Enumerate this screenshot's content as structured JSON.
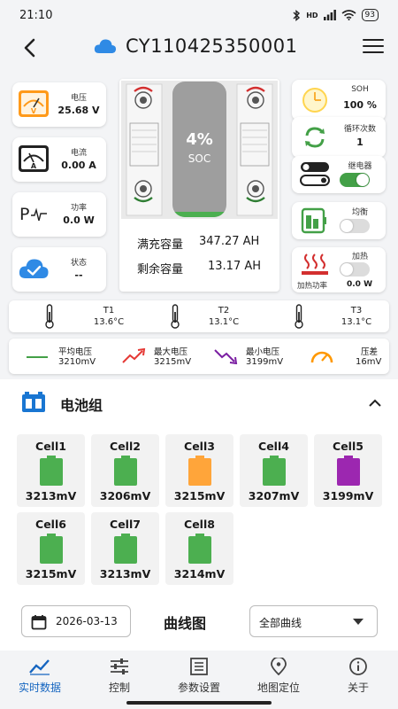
{
  "status_bar": {
    "time": "21:10",
    "network": "HD",
    "battery": "93"
  },
  "header": {
    "title": "CY110425350001"
  },
  "left_metrics": [
    {
      "label": "电压",
      "value": "25.68 V"
    },
    {
      "label": "电流",
      "value": "0.00 A"
    },
    {
      "label": "功率",
      "value": "0.0 W"
    },
    {
      "label": "状态",
      "value": "--"
    }
  ],
  "battery_center": {
    "soc_percent": "4%",
    "soc_label": "SOC",
    "soc_fraction": 0.04,
    "full_capacity_label": "满充容量",
    "full_capacity_value": "347.27 AH",
    "remaining_capacity_label": "剩余容量",
    "remaining_capacity_value": "13.17 AH"
  },
  "right_metrics": {
    "soh": {
      "label": "SOH",
      "value": "100 %"
    },
    "cycles": {
      "label": "循环次数",
      "value": "1"
    },
    "relay": {
      "label": "继电器",
      "on": true
    },
    "balance": {
      "label": "均衡",
      "on": false
    },
    "heating": {
      "label": "加热",
      "on": false,
      "power_label": "加热功率",
      "power_value": "0.0 W"
    }
  },
  "temperatures": [
    {
      "label": "T1",
      "value": "13.6°C"
    },
    {
      "label": "T2",
      "value": "13.1°C"
    },
    {
      "label": "T3",
      "value": "13.1°C"
    }
  ],
  "voltage_stats": [
    {
      "label": "平均电压",
      "value": "3210mV"
    },
    {
      "label": "最大电压",
      "value": "3215mV"
    },
    {
      "label": "最小电压",
      "value": "3199mV"
    },
    {
      "label": "压差",
      "value": "16mV"
    }
  ],
  "battery_pack": {
    "title": "电池组",
    "cells": [
      {
        "name": "Cell1",
        "voltage": "3213mV",
        "color": "#4caf50"
      },
      {
        "name": "Cell2",
        "voltage": "3206mV",
        "color": "#4caf50"
      },
      {
        "name": "Cell3",
        "voltage": "3215mV",
        "color": "#ffa53a"
      },
      {
        "name": "Cell4",
        "voltage": "3207mV",
        "color": "#4caf50"
      },
      {
        "name": "Cell5",
        "voltage": "3199mV",
        "color": "#9c27b0"
      },
      {
        "name": "Cell6",
        "voltage": "3215mV",
        "color": "#4caf50"
      },
      {
        "name": "Cell7",
        "voltage": "3213mV",
        "color": "#4caf50"
      },
      {
        "name": "Cell8",
        "voltage": "3214mV",
        "color": "#4caf50"
      }
    ]
  },
  "curve_section": {
    "date": "2026-03-13",
    "title": "曲线图",
    "selected_option": "全部曲线"
  },
  "bottom_nav": [
    {
      "label": "实时数据",
      "active": true
    },
    {
      "label": "控制",
      "active": false
    },
    {
      "label": "参数设置",
      "active": false
    },
    {
      "label": "地图定位",
      "active": false
    },
    {
      "label": "关于",
      "active": false
    }
  ],
  "colors": {
    "accent_blue": "#1565c0",
    "toggle_on": "#43a047",
    "toggle_off": "#dcdcdc",
    "cloud_blue": "#2f8ae5",
    "gauge_orange": "#ff9800"
  }
}
